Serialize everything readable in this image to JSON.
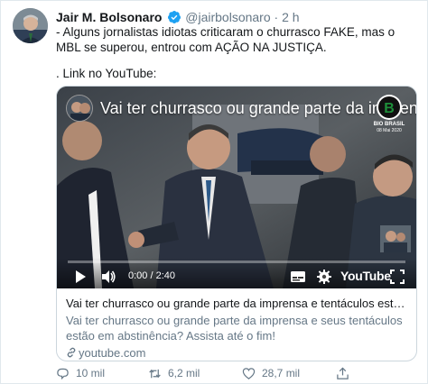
{
  "tweet": {
    "author_name": "Jair M. Bolsonaro",
    "handle": "@jairbolsonaro",
    "separator": "·",
    "time": "2 h",
    "text_line1": "- Alguns jornalistas idiotas criticaram o churrasco FAKE, mas o MBL se superou, entrou com AÇÃO NA JUSTIÇA.",
    "text_line2": ". Link no YouTube:"
  },
  "video": {
    "title": "Vai ter churrasco ou grande parte da imprensa...",
    "channel_logo_text": "B",
    "channel_name": "BIO BRASIL",
    "channel_date": "08 Mai 2020",
    "current_time": "0:00 / 2:40",
    "progress": 0.0,
    "youtube_logo": "YouTube"
  },
  "card": {
    "title": "Vai ter churrasco ou grande parte da imprensa e tentáculos estão em...",
    "description": "Vai ter churrasco ou grande parte da imprensa e seus tentáculos estão em abstinência? Assista até o fim!",
    "domain": "youtube.com"
  },
  "actions": {
    "replies": "10 mil",
    "retweets": "6,2 mil",
    "likes": "28,7 mil"
  },
  "icons": {
    "verified": "verified-badge-icon",
    "play": "play-icon",
    "volume": "volume-icon",
    "subtitles": "subtitles-icon",
    "settings": "gear-icon",
    "fullscreen": "fullscreen-icon",
    "link": "link-icon",
    "reply": "reply-icon",
    "retweet": "retweet-icon",
    "like": "heart-icon",
    "share": "share-icon"
  },
  "colors": {
    "verified_blue": "#1da1f2",
    "muted_text": "#657786",
    "progress_red": "#ff0000",
    "logo_green": "#1e8f3a"
  }
}
